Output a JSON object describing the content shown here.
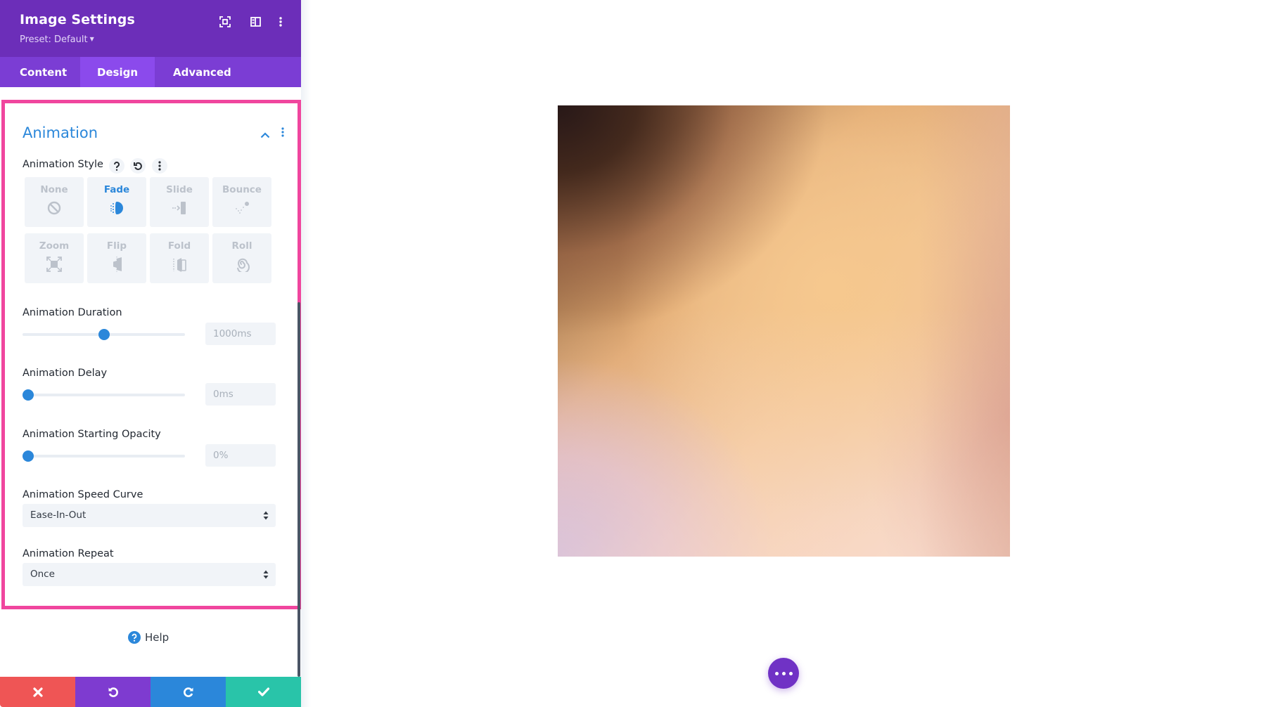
{
  "panel": {
    "title": "Image Settings",
    "preset_label": "Preset: Default",
    "header_icons": [
      "expand-icon",
      "split-view-icon",
      "more-options-icon"
    ],
    "tabs": [
      {
        "label": "Content",
        "active": false
      },
      {
        "label": "Design",
        "active": true
      },
      {
        "label": "Advanced",
        "active": false
      }
    ]
  },
  "animation": {
    "section_title": "Animation",
    "style": {
      "label": "Animation Style",
      "options": [
        {
          "label": "None",
          "icon": "none-icon",
          "selected": false
        },
        {
          "label": "Fade",
          "icon": "fade-icon",
          "selected": true
        },
        {
          "label": "Slide",
          "icon": "slide-icon",
          "selected": false
        },
        {
          "label": "Bounce",
          "icon": "bounce-icon",
          "selected": false
        },
        {
          "label": "Zoom",
          "icon": "zoom-icon",
          "selected": false
        },
        {
          "label": "Flip",
          "icon": "flip-icon",
          "selected": false
        },
        {
          "label": "Fold",
          "icon": "fold-icon",
          "selected": false
        },
        {
          "label": "Roll",
          "icon": "roll-icon",
          "selected": false
        }
      ]
    },
    "duration": {
      "label": "Animation Duration",
      "value": "1000ms",
      "slider_fraction": 0.5
    },
    "delay": {
      "label": "Animation Delay",
      "value": "0ms",
      "slider_fraction": 0.0
    },
    "opacity": {
      "label": "Animation Starting Opacity",
      "value": "0%",
      "slider_fraction": 0.0
    },
    "speed_curve": {
      "label": "Animation Speed Curve",
      "value": "Ease-In-Out"
    },
    "repeat": {
      "label": "Animation Repeat",
      "value": "Once"
    }
  },
  "help_label": "Help",
  "footer": {
    "buttons": [
      "close",
      "undo",
      "redo",
      "save"
    ]
  },
  "colors": {
    "header": "#6c2eb9",
    "tab_bar": "#7b3dd4",
    "tab_active": "#8b4aec",
    "accent_blue": "#2b87da",
    "highlight_pink": "#f0469e",
    "close": "#ef5555",
    "undo": "#7e3bd0",
    "redo": "#2b87da",
    "save": "#29c4a9",
    "fab": "#7032c5"
  }
}
